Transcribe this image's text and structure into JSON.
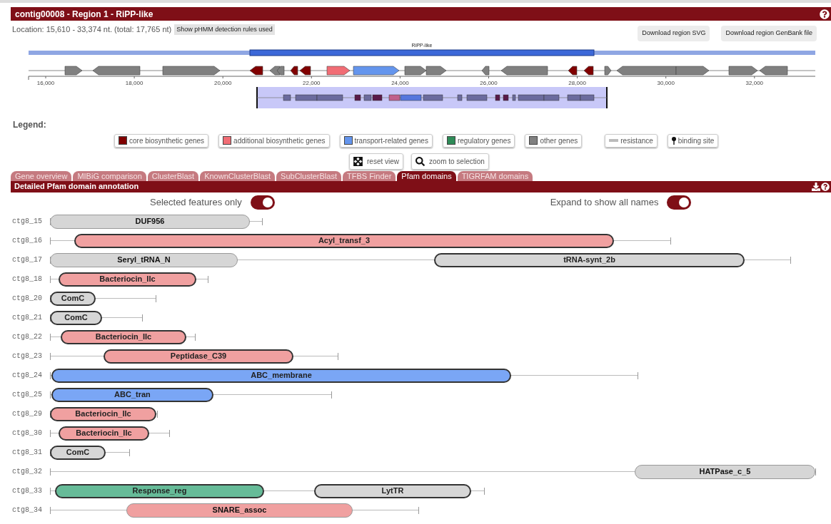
{
  "region_header": {
    "title": "contig00008 - Region 1 - RiPP-like"
  },
  "location": {
    "text": "Location: 15,610 - 33,374 nt. (total: 17,765 nt)",
    "rules_button": "Show pHMM detection rules used"
  },
  "download_buttons": [
    "Download region SVG",
    "Download region GenBank file"
  ],
  "region_map": {
    "region_label": "RiPP-like",
    "axis_ticks": [
      "16,000",
      "18,000",
      "20,000",
      "22,000",
      "24,000",
      "26,000",
      "28,000",
      "30,000",
      "32,000"
    ]
  },
  "legend": {
    "title": "Legend:",
    "items": [
      {
        "label": "core biosynthetic genes",
        "kind": "swatch",
        "color": "#800000"
      },
      {
        "label": "additional biosynthetic genes",
        "kind": "swatch",
        "color": "#f16d75"
      },
      {
        "label": "transport-related genes",
        "kind": "swatch",
        "color": "#6495ed"
      },
      {
        "label": "regulatory genes",
        "kind": "swatch",
        "color": "#2e8b57"
      },
      {
        "label": "other genes",
        "kind": "swatch",
        "color": "#808080"
      },
      {
        "label": "resistance",
        "kind": "bar"
      },
      {
        "label": "binding site",
        "kind": "pin"
      }
    ]
  },
  "view_buttons": [
    {
      "label": "reset view",
      "kind": "reset"
    },
    {
      "label": "zoom to selection",
      "kind": "zoom"
    }
  ],
  "tabs": [
    {
      "label": "Gene overview",
      "selected": false
    },
    {
      "label": "MIBiG comparison",
      "selected": false
    },
    {
      "label": "ClusterBlast",
      "selected": false
    },
    {
      "label": "KnownClusterBlast",
      "selected": false
    },
    {
      "label": "SubClusterBlast",
      "selected": false
    },
    {
      "label": "TFBS Finder",
      "selected": false
    },
    {
      "label": "Pfam domains",
      "selected": true
    },
    {
      "label": "TIGRFAM domains",
      "selected": false
    }
  ],
  "panel": {
    "title": "Detailed Pfam domain annotation",
    "toggles": [
      {
        "label": "Selected features only",
        "on": true
      },
      {
        "label": "Expand to show all names",
        "on": true
      }
    ],
    "rows": [
      {
        "gene": "ctg8_15",
        "domains": [
          {
            "name": "DUF956",
            "color": "#d6d6d6",
            "selected": false
          }
        ]
      },
      {
        "gene": "ctg8_16",
        "domains": [
          {
            "name": "Acyl_transf_3",
            "color": "#f0a0a0",
            "selected": true
          }
        ]
      },
      {
        "gene": "ctg8_17",
        "domains": [
          {
            "name": "Seryl_tRNA_N",
            "color": "#d6d6d6",
            "selected": false
          },
          {
            "name": "tRNA-synt_2b",
            "color": "#d6d6d6",
            "selected": true
          }
        ]
      },
      {
        "gene": "ctg8_18",
        "domains": [
          {
            "name": "Bacteriocin_IIc",
            "color": "#f0a0a0",
            "selected": true
          }
        ]
      },
      {
        "gene": "ctg8_20",
        "domains": [
          {
            "name": "ComC",
            "color": "#d6d6d6",
            "selected": true
          }
        ]
      },
      {
        "gene": "ctg8_21",
        "domains": [
          {
            "name": "ComC",
            "color": "#d6d6d6",
            "selected": true
          }
        ]
      },
      {
        "gene": "ctg8_22",
        "domains": [
          {
            "name": "Bacteriocin_IIc",
            "color": "#f0a0a0",
            "selected": true
          }
        ]
      },
      {
        "gene": "ctg8_23",
        "domains": [
          {
            "name": "Peptidase_C39",
            "color": "#f0a0a0",
            "selected": true
          }
        ]
      },
      {
        "gene": "ctg8_24",
        "domains": [
          {
            "name": "ABC_membrane",
            "color": "#7aa6f5",
            "selected": true
          }
        ]
      },
      {
        "gene": "ctg8_25",
        "domains": [
          {
            "name": "ABC_tran",
            "color": "#7aa6f5",
            "selected": true
          }
        ]
      },
      {
        "gene": "ctg8_29",
        "domains": [
          {
            "name": "Bacteriocin_IIc",
            "color": "#f0a0a0",
            "selected": true
          }
        ]
      },
      {
        "gene": "ctg8_30",
        "domains": [
          {
            "name": "Bacteriocin_IIc",
            "color": "#f0a0a0",
            "selected": true
          }
        ]
      },
      {
        "gene": "ctg8_31",
        "domains": [
          {
            "name": "ComC",
            "color": "#d6d6d6",
            "selected": true
          }
        ]
      },
      {
        "gene": "ctg8_32",
        "domains": [
          {
            "name": "HATPase_c_5",
            "color": "#d6d6d6",
            "selected": false
          }
        ]
      },
      {
        "gene": "ctg8_33",
        "domains": [
          {
            "name": "Response_reg",
            "color": "#66bb98",
            "selected": true
          },
          {
            "name": "LytTR",
            "color": "#d6d6d6",
            "selected": true
          }
        ]
      },
      {
        "gene": "ctg8_34",
        "domains": [
          {
            "name": "SNARE_assoc",
            "color": "#f0a0a0",
            "selected": false
          }
        ]
      }
    ]
  }
}
